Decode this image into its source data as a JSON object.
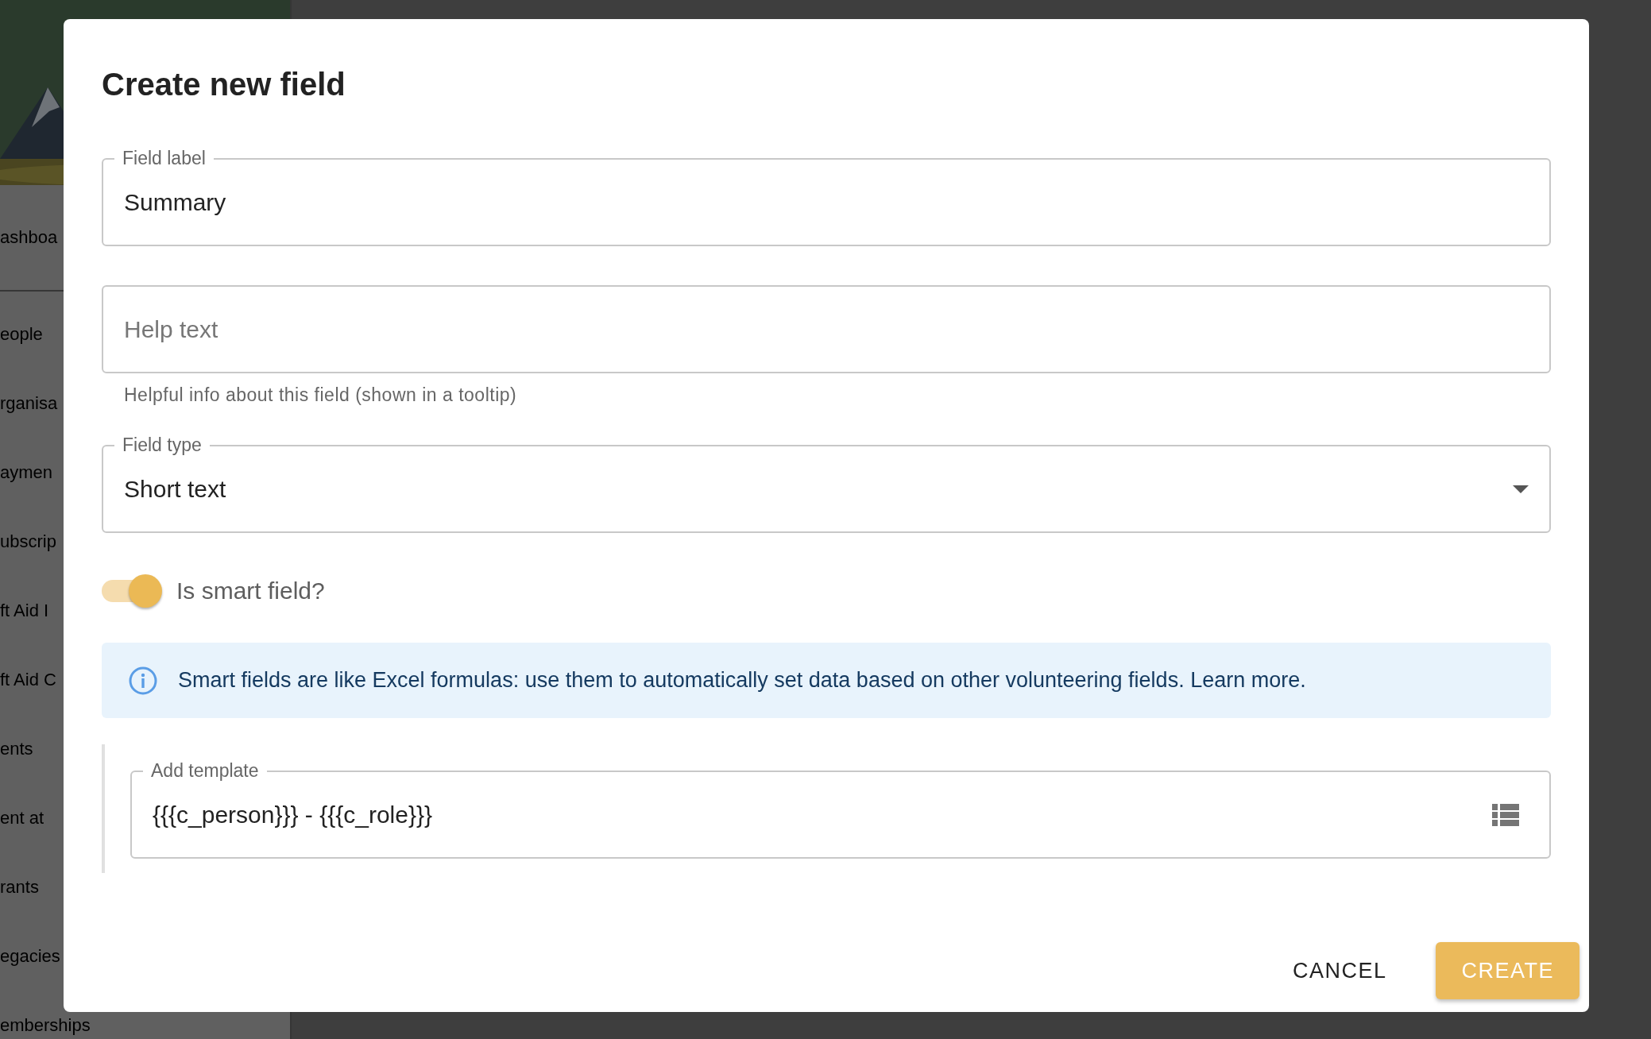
{
  "sidebar": {
    "header_item": "ashboa",
    "items": [
      {
        "label": "eople"
      },
      {
        "label": "rganisa"
      },
      {
        "label": "aymen"
      },
      {
        "label": "ubscrip"
      },
      {
        "label": "ft Aid I"
      },
      {
        "label": "ft Aid C"
      },
      {
        "label": "ents"
      },
      {
        "label": "ent at"
      },
      {
        "label": "rants"
      },
      {
        "label": "egacies"
      },
      {
        "label": "emberships"
      }
    ]
  },
  "dialog": {
    "title": "Create new field",
    "fields": [
      {
        "kind": "text",
        "label": "Field label",
        "value": "Summary"
      },
      {
        "kind": "text",
        "placeholder": "Help text",
        "helper": "Helpful info about this field (shown in a tooltip)"
      },
      {
        "kind": "select",
        "label": "Field type",
        "value": "Short text"
      }
    ],
    "toggle": {
      "label": "Is smart field?",
      "on": true
    },
    "info": {
      "text": "Smart fields are like Excel formulas: use them to automatically set data based on other volunteering fields.",
      "link": "Learn more."
    },
    "template": {
      "label": "Add template",
      "value": "{{{c_person}}} - {{{c_role}}}"
    },
    "buttons": [
      {
        "label": "CANCEL",
        "kind": "text"
      },
      {
        "label": "CREATE",
        "kind": "contained"
      }
    ]
  }
}
